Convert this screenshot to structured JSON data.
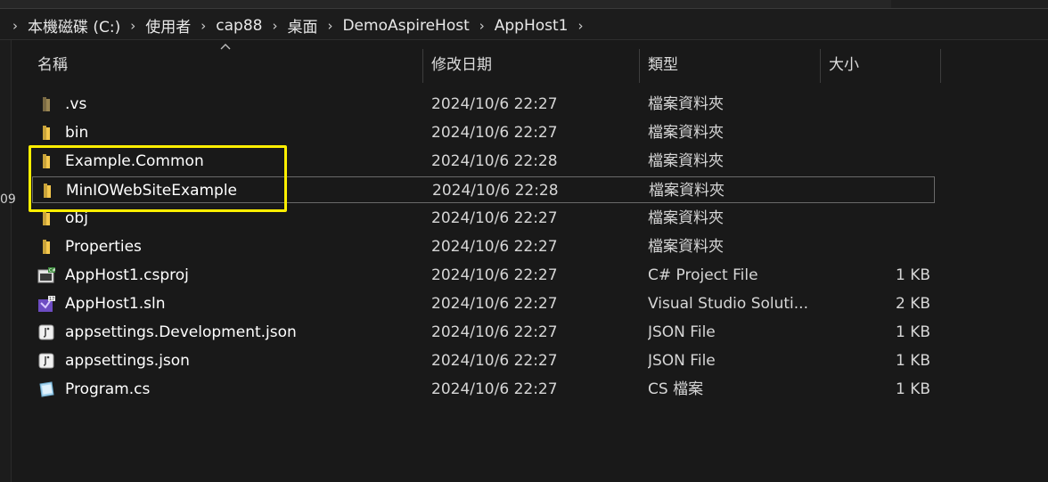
{
  "breadcrumb": [
    "本機磁碟 (C:)",
    "使用者",
    "cap88",
    "桌面",
    "DemoAspireHost",
    "AppHost1"
  ],
  "side_number": "09",
  "columns": {
    "name": "名稱",
    "date": "修改日期",
    "type": "類型",
    "size": "大小"
  },
  "files": [
    {
      "name": ".vs",
      "date": "2024/10/6 22:27",
      "type": "檔案資料夾",
      "size": "",
      "icon": "folder-icon-dim"
    },
    {
      "name": "bin",
      "date": "2024/10/6 22:27",
      "type": "檔案資料夾",
      "size": "",
      "icon": "folder-icon"
    },
    {
      "name": "Example.Common",
      "date": "2024/10/6 22:28",
      "type": "檔案資料夾",
      "size": "",
      "icon": "folder-icon"
    },
    {
      "name": "MinIOWebSiteExample",
      "date": "2024/10/6 22:28",
      "type": "檔案資料夾",
      "size": "",
      "icon": "folder-icon"
    },
    {
      "name": "obj",
      "date": "2024/10/6 22:27",
      "type": "檔案資料夾",
      "size": "",
      "icon": "folder-icon"
    },
    {
      "name": "Properties",
      "date": "2024/10/6 22:27",
      "type": "檔案資料夾",
      "size": "",
      "icon": "folder-icon"
    },
    {
      "name": "AppHost1.csproj",
      "date": "2024/10/6 22:27",
      "type": "C# Project File",
      "size": "1 KB",
      "icon": "csproj-icon"
    },
    {
      "name": "AppHost1.sln",
      "date": "2024/10/6 22:27",
      "type": "Visual Studio Soluti...",
      "size": "2 KB",
      "icon": "visual-studio-icon"
    },
    {
      "name": "appsettings.Development.json",
      "date": "2024/10/6 22:27",
      "type": "JSON File",
      "size": "1 KB",
      "icon": "json-file-icon"
    },
    {
      "name": "appsettings.json",
      "date": "2024/10/6 22:27",
      "type": "JSON File",
      "size": "1 KB",
      "icon": "json-file-icon"
    },
    {
      "name": "Program.cs",
      "date": "2024/10/6 22:27",
      "type": "CS 檔案",
      "size": "1 KB",
      "icon": "cs-file-icon"
    }
  ],
  "colors": {
    "background": "#191919",
    "folder": "#f5c84c",
    "highlight": "#ffef00"
  }
}
